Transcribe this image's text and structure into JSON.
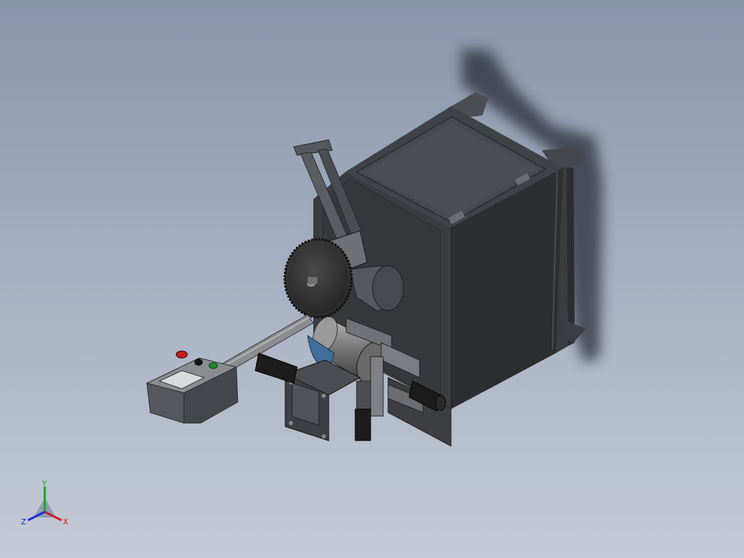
{
  "viewport": {
    "background_top": "#8895aa",
    "background_bottom": "#c4cad5"
  },
  "model": {
    "parts": [
      "cabinet",
      "saw-blade",
      "blade-arm",
      "motor",
      "gear-housing",
      "vise-clamp",
      "control-box",
      "support-rod",
      "shadow"
    ],
    "control_box": {
      "buttons": [
        {
          "name": "red-stop-button",
          "color": "#c81e1e"
        },
        {
          "name": "black-knob",
          "color": "#151515"
        },
        {
          "name": "green-start-button",
          "color": "#1f8f2c"
        }
      ]
    }
  },
  "triad": {
    "x_label": "X",
    "y_label": "Y",
    "z_label": "Z",
    "x_color": "#d01a1a",
    "y_color": "#19a319",
    "z_color": "#1a2fd0"
  }
}
